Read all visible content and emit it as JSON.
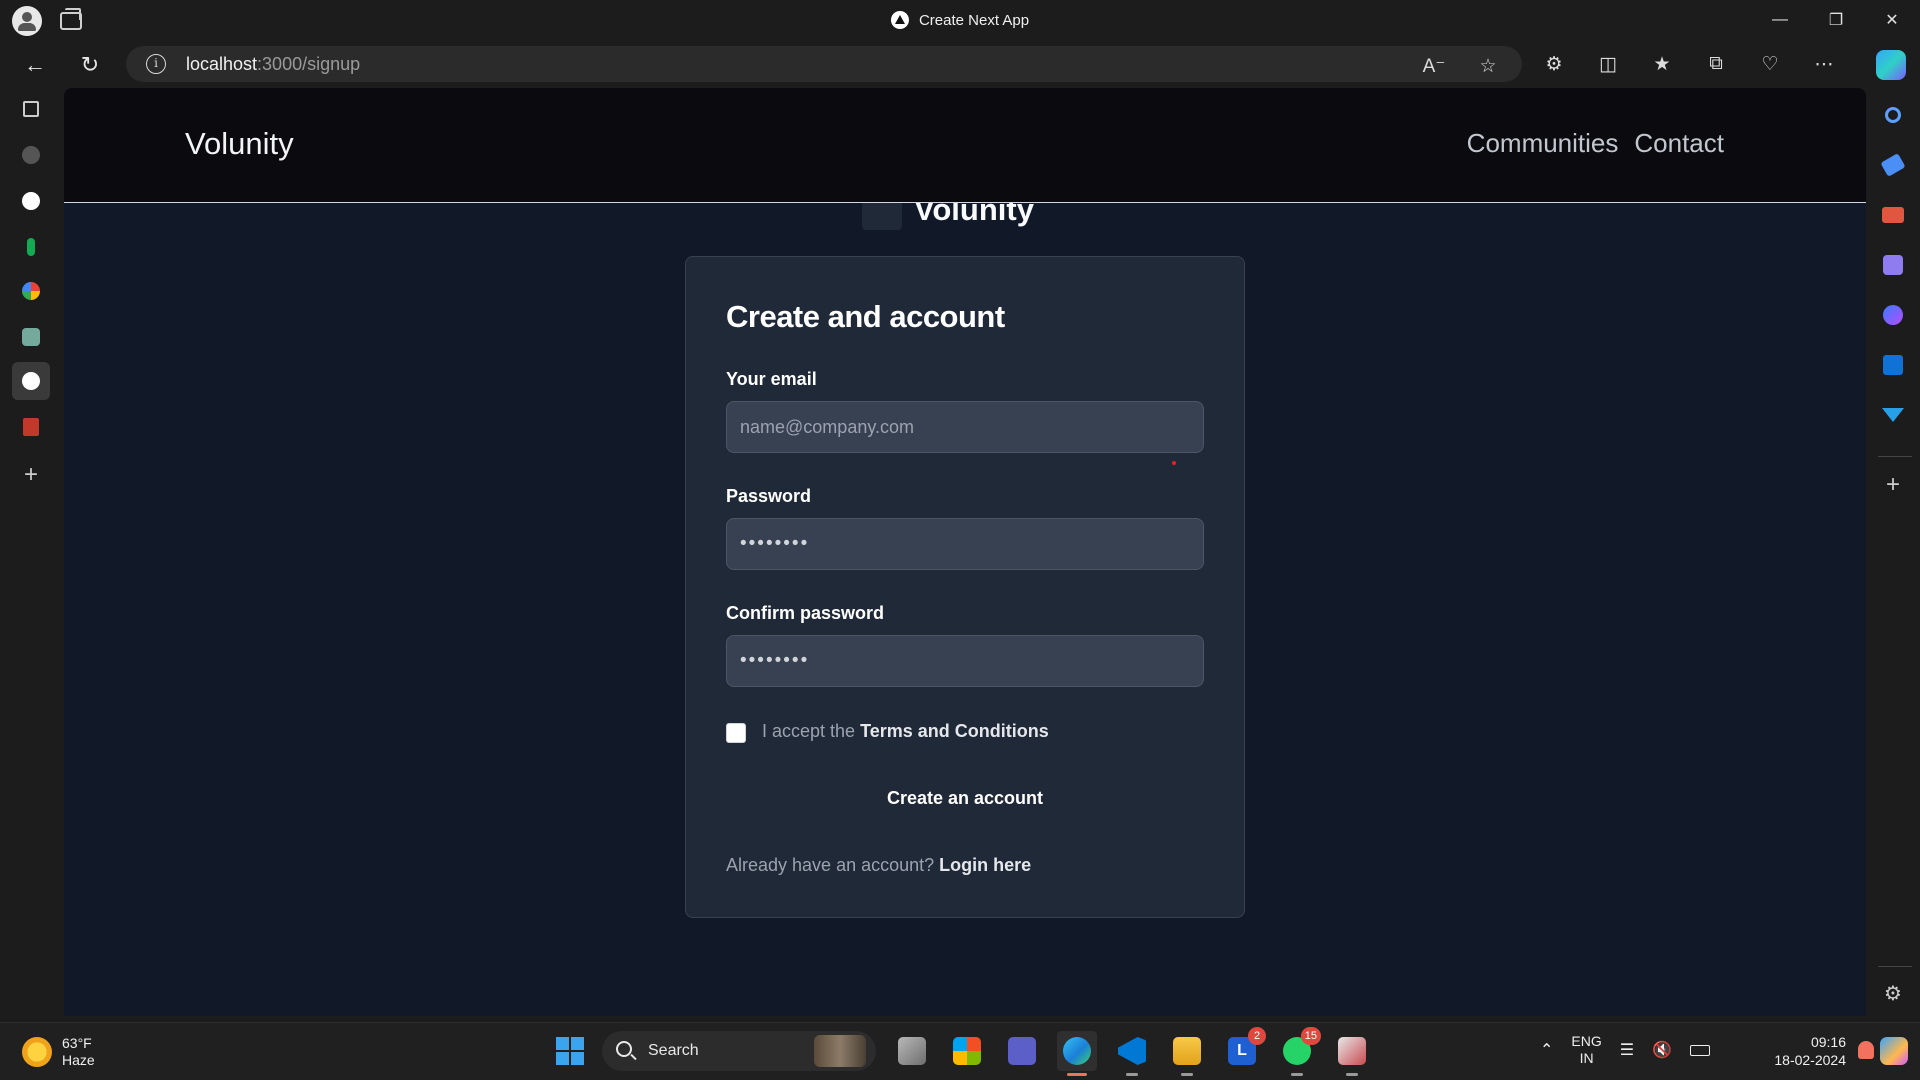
{
  "browser": {
    "tab_title": "Create Next App",
    "url_host": "localhost",
    "url_rest": ":3000/signup"
  },
  "site": {
    "brand": "Volunity",
    "nav_links": [
      "Communities",
      "Contact"
    ],
    "hidden_brand": "Volunity"
  },
  "signup": {
    "title": "Create and account",
    "email_label": "Your email",
    "email_placeholder": "name@company.com",
    "password_label": "Password",
    "password_value": "••••••••",
    "confirm_label": "Confirm password",
    "confirm_value": "••••••••",
    "accept_prefix": "I accept the",
    "terms_link": "Terms and Conditions",
    "submit_label": "Create an account",
    "login_prompt": "Already have an account?",
    "login_link": "Login here"
  },
  "taskbar": {
    "weather_temp": "63°F",
    "weather_desc": "Haze",
    "search_label": "Search",
    "badge_l": "2",
    "badge_whatsapp": "15",
    "lang_1": "ENG",
    "lang_2": "IN",
    "time": "09:16",
    "date": "18-02-2024"
  },
  "colors": {
    "page_bg": "#111827",
    "card_bg": "#1f2937",
    "input_bg": "#374151",
    "nav_bg": "#0b0b0f"
  }
}
